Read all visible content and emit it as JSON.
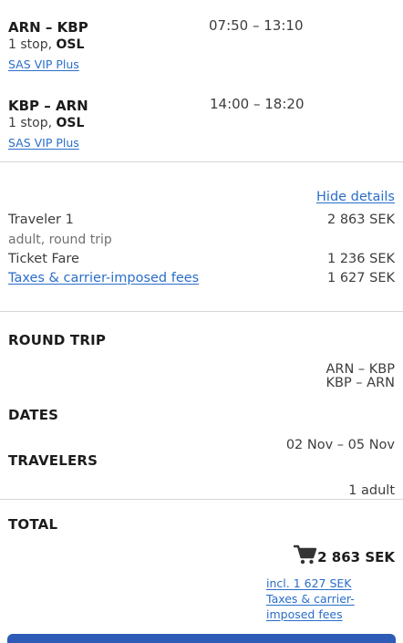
{
  "flights": [
    {
      "route": "ARN – KBP",
      "time": "07:50 – 13:10",
      "stops_prefix": "1 stop, ",
      "stops_via": "OSL",
      "fare_class": "SAS VIP Plus"
    },
    {
      "route": "KBP – ARN",
      "time": "14:00 – 18:20",
      "stops_prefix": "1 stop, ",
      "stops_via": "OSL",
      "fare_class": "SAS VIP Plus"
    }
  ],
  "details": {
    "hide_details_label": "Hide details",
    "traveler_label": "Traveler 1",
    "traveler_total": "2 863 SEK",
    "traveler_sub": "adult, round trip",
    "ticket_fare_label": "Ticket Fare",
    "ticket_fare_value": "1 236 SEK",
    "taxes_label": "Taxes & carrier-imposed fees",
    "taxes_value": "1 627 SEK"
  },
  "summary": {
    "round_trip_heading": "ROUND TRIP",
    "routes": [
      "ARN – KBP",
      "KBP – ARN"
    ],
    "dates_heading": "DATES",
    "dates_value": "02 Nov – 05 Nov",
    "travelers_heading": "TRAVELERS",
    "travelers_value": "1 adult",
    "total_heading": "TOTAL",
    "total_price": "2 863 SEK",
    "incl_taxes_line1": "incl. 1 627 SEK",
    "incl_taxes_line2": "Taxes & carrier-imposed fees"
  },
  "icons": {
    "cart": "shopping-cart-icon"
  },
  "colors": {
    "link": "#2a6ec9",
    "primary_button": "#2d5bb5"
  }
}
